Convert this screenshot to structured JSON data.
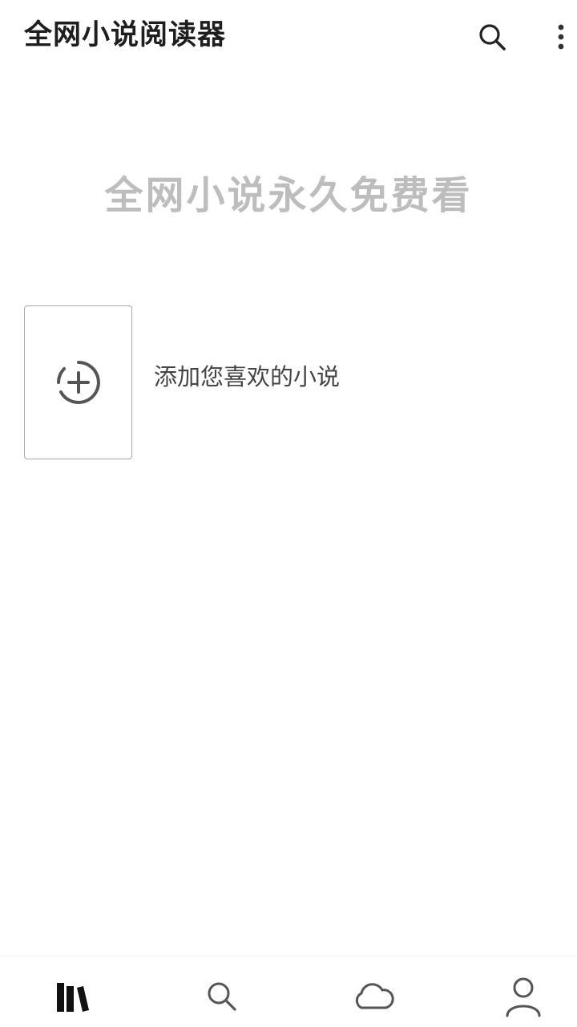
{
  "app_bar": {
    "title": "全网小说阅读器",
    "search_icon": "search-icon",
    "more_icon": "more-vertical-icon"
  },
  "main": {
    "slogan": "全网小说永久免费看",
    "add_card": {
      "icon": "add-circle-icon",
      "label": "添加您喜欢的小说"
    }
  },
  "bottom_nav": {
    "items": [
      {
        "icon": "bookshelf-icon",
        "active": true
      },
      {
        "icon": "search-icon",
        "active": false
      },
      {
        "icon": "cloud-icon",
        "active": false
      },
      {
        "icon": "profile-icon",
        "active": false
      }
    ]
  },
  "colors": {
    "title": "#1e1e1e",
    "slogan": "#bdbdbd",
    "card_border": "#a8a8a8",
    "icon": "#555555",
    "active_icon": "#111111"
  }
}
